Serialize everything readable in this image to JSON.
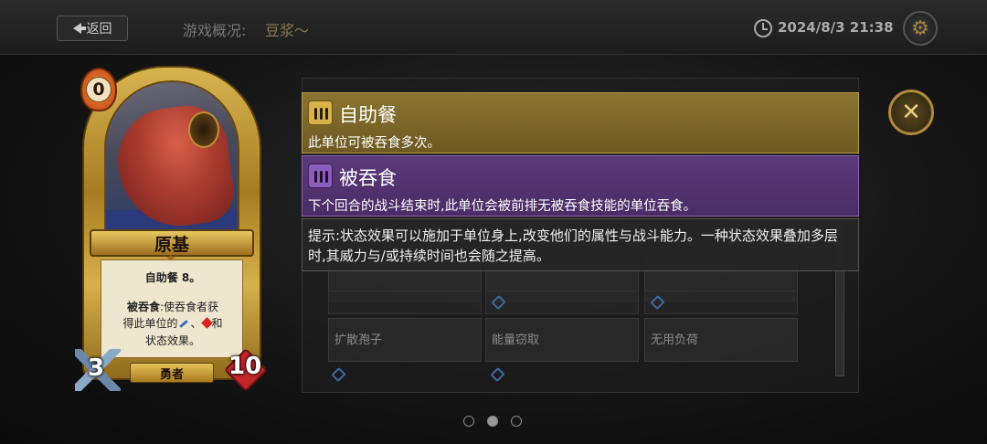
{
  "topbar": {
    "back_label": "返回",
    "title_label": "游戏概况:",
    "title_value": "豆浆～",
    "datetime": "2024/8/3 21:38"
  },
  "icons": {
    "back": "back-arrow-icon",
    "clock": "clock-icon",
    "settings": "gear-icon",
    "close": "close-icon"
  },
  "card": {
    "cost": "0",
    "name": "原基",
    "line1": "自助餐 8。",
    "line2_bold": "被吞食",
    "line2_rest": ":使吞食者获",
    "line3_a": "得此单位的",
    "line3_b": "、",
    "line3_c": "和",
    "line4": "状态效果。",
    "attack": "3",
    "health": "10",
    "tribe": "勇者"
  },
  "tooltips": [
    {
      "title": "自助餐",
      "desc": "此单位可被吞食多次。",
      "color": "#8a7430"
    },
    {
      "title": "被吞食",
      "desc": "下个回合的战斗结束时,此单位会被前排无被吞食技能的单位吞食。",
      "color": "#5b3a7a"
    }
  ],
  "hint": {
    "text": "提示:状态效果可以施加于单位身上,改变他们的属性与战斗能力。一种状态效果叠加多层时,其威力与/或持续时间也会随之提高。"
  },
  "background_table": {
    "cells": [
      "扩散孢子",
      "能量窃取",
      "无用负荷"
    ]
  },
  "pager": {
    "count": 3,
    "active_index": 1
  }
}
